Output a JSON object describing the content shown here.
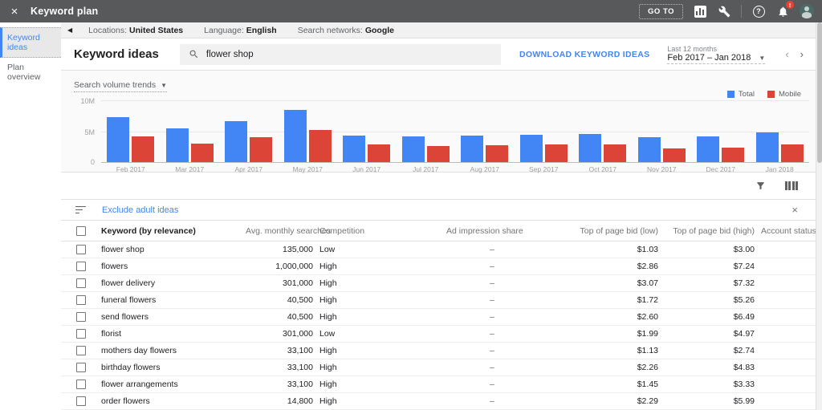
{
  "colors": {
    "accent_blue": "#4285f4",
    "bar_red": "#db4437",
    "header_bg": "#58595b"
  },
  "header": {
    "title": "Keyword plan",
    "close_icon": "×",
    "go_to_label": "GO TO",
    "badge": "!",
    "help_glyph": "?"
  },
  "sidebar": {
    "items": [
      {
        "label": "Keyword ideas",
        "active": true
      },
      {
        "label": "Plan overview",
        "active": false
      }
    ]
  },
  "settings_bar": {
    "back_glyph": "◀",
    "items": [
      {
        "label": "Locations:",
        "value": "United States"
      },
      {
        "label": "Language:",
        "value": "English"
      },
      {
        "label": "Search networks:",
        "value": "Google"
      }
    ]
  },
  "toolbar": {
    "page_title": "Keyword ideas",
    "search_value": "flower shop",
    "download_label": "DOWNLOAD KEYWORD IDEAS",
    "range_caption": "Last 12 months",
    "range_value": "Feb 2017 – Jan 2018",
    "range_dd_glyph": "▼",
    "prev_glyph": "‹",
    "next_glyph": "›"
  },
  "chart": {
    "dropdown_label": "Search volume trends",
    "dropdown_glyph": "▼",
    "y_ticks": [
      "10M",
      "5M",
      "0"
    ]
  },
  "chart_data": {
    "type": "bar",
    "title": "Search volume trends",
    "categories": [
      "Feb 2017",
      "Mar 2017",
      "Apr 2017",
      "May 2017",
      "Jun 2017",
      "Jul 2017",
      "Aug 2017",
      "Sep 2017",
      "Oct 2017",
      "Nov 2017",
      "Dec 2017",
      "Jan 2018"
    ],
    "series": [
      {
        "name": "Total",
        "color": "#4285f4",
        "values": [
          7.3,
          5.4,
          6.6,
          8.4,
          4.3,
          4.1,
          4.3,
          4.4,
          4.5,
          4.0,
          4.2,
          4.8
        ]
      },
      {
        "name": "Mobile",
        "color": "#db4437",
        "values": [
          4.2,
          3.0,
          4.0,
          5.2,
          2.8,
          2.6,
          2.7,
          2.8,
          2.8,
          2.2,
          2.3,
          2.9
        ]
      }
    ],
    "unit": "millions of searches",
    "ylim": [
      0,
      10
    ],
    "y_tick_labels": [
      "0",
      "5M",
      "10M"
    ],
    "legend_position": "top-right",
    "grid": true
  },
  "filter_bar": {
    "link": "Exclude adult ideas",
    "close_glyph": "×"
  },
  "table": {
    "headers": [
      "Keyword (by relevance)",
      "Avg. monthly searches",
      "Competition",
      "Ad impression share",
      "Top of page bid (low)",
      "Top of page bid (high)",
      "Account status"
    ],
    "rows": [
      {
        "keyword": "flower shop",
        "avg_monthly_searches": "135,000",
        "competition": "Low",
        "ad_impression_share": "–",
        "bid_low": "$1.03",
        "bid_high": "$3.00",
        "account_status": ""
      },
      {
        "keyword": "flowers",
        "avg_monthly_searches": "1,000,000",
        "competition": "High",
        "ad_impression_share": "–",
        "bid_low": "$2.86",
        "bid_high": "$7.24",
        "account_status": ""
      },
      {
        "keyword": "flower delivery",
        "avg_monthly_searches": "301,000",
        "competition": "High",
        "ad_impression_share": "–",
        "bid_low": "$3.07",
        "bid_high": "$7.32",
        "account_status": ""
      },
      {
        "keyword": "funeral flowers",
        "avg_monthly_searches": "40,500",
        "competition": "High",
        "ad_impression_share": "–",
        "bid_low": "$1.72",
        "bid_high": "$5.26",
        "account_status": ""
      },
      {
        "keyword": "send flowers",
        "avg_monthly_searches": "40,500",
        "competition": "High",
        "ad_impression_share": "–",
        "bid_low": "$2.60",
        "bid_high": "$6.49",
        "account_status": ""
      },
      {
        "keyword": "florist",
        "avg_monthly_searches": "301,000",
        "competition": "Low",
        "ad_impression_share": "–",
        "bid_low": "$1.99",
        "bid_high": "$4.97",
        "account_status": ""
      },
      {
        "keyword": "mothers day flowers",
        "avg_monthly_searches": "33,100",
        "competition": "High",
        "ad_impression_share": "–",
        "bid_low": "$1.13",
        "bid_high": "$2.74",
        "account_status": ""
      },
      {
        "keyword": "birthday flowers",
        "avg_monthly_searches": "33,100",
        "competition": "High",
        "ad_impression_share": "–",
        "bid_low": "$2.26",
        "bid_high": "$4.83",
        "account_status": ""
      },
      {
        "keyword": "flower arrangements",
        "avg_monthly_searches": "33,100",
        "competition": "High",
        "ad_impression_share": "–",
        "bid_low": "$1.45",
        "bid_high": "$3.33",
        "account_status": ""
      },
      {
        "keyword": "order flowers",
        "avg_monthly_searches": "14,800",
        "competition": "High",
        "ad_impression_share": "–",
        "bid_low": "$2.29",
        "bid_high": "$5.99",
        "account_status": ""
      }
    ]
  }
}
